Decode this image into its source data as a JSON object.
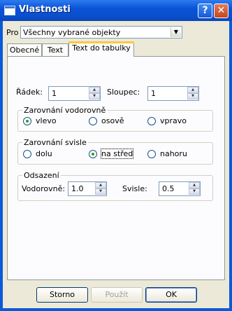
{
  "window": {
    "title": "Vlastnosti",
    "help_glyph": "?",
    "close_glyph": "✕"
  },
  "scope": {
    "label": "Pro",
    "value": "Všechny vybrané objekty"
  },
  "tabs": [
    {
      "label": "Obecné"
    },
    {
      "label": "Text"
    },
    {
      "label": "Text do tabulky"
    }
  ],
  "active_tab": "Text do tabulky",
  "row": {
    "label": "Řádek:",
    "value": "1"
  },
  "column": {
    "label": "Sloupec:",
    "value": "1"
  },
  "halign": {
    "legend": "Zarovnání vodorovně",
    "options": [
      "vlevo",
      "osově",
      "vpravo"
    ],
    "selected": "vlevo"
  },
  "valign": {
    "legend": "Zarovnání svisle",
    "options": [
      "dolu",
      "na střed",
      "nahoru"
    ],
    "selected": "na střed"
  },
  "offset": {
    "legend": "Odsazení",
    "horizontal_label": "Vodorovně:",
    "horizontal_value": "1.0",
    "vertical_label": "Svisle:",
    "vertical_value": "0.5"
  },
  "buttons": {
    "cancel": "Storno",
    "apply": "Použít",
    "ok": "OK"
  }
}
